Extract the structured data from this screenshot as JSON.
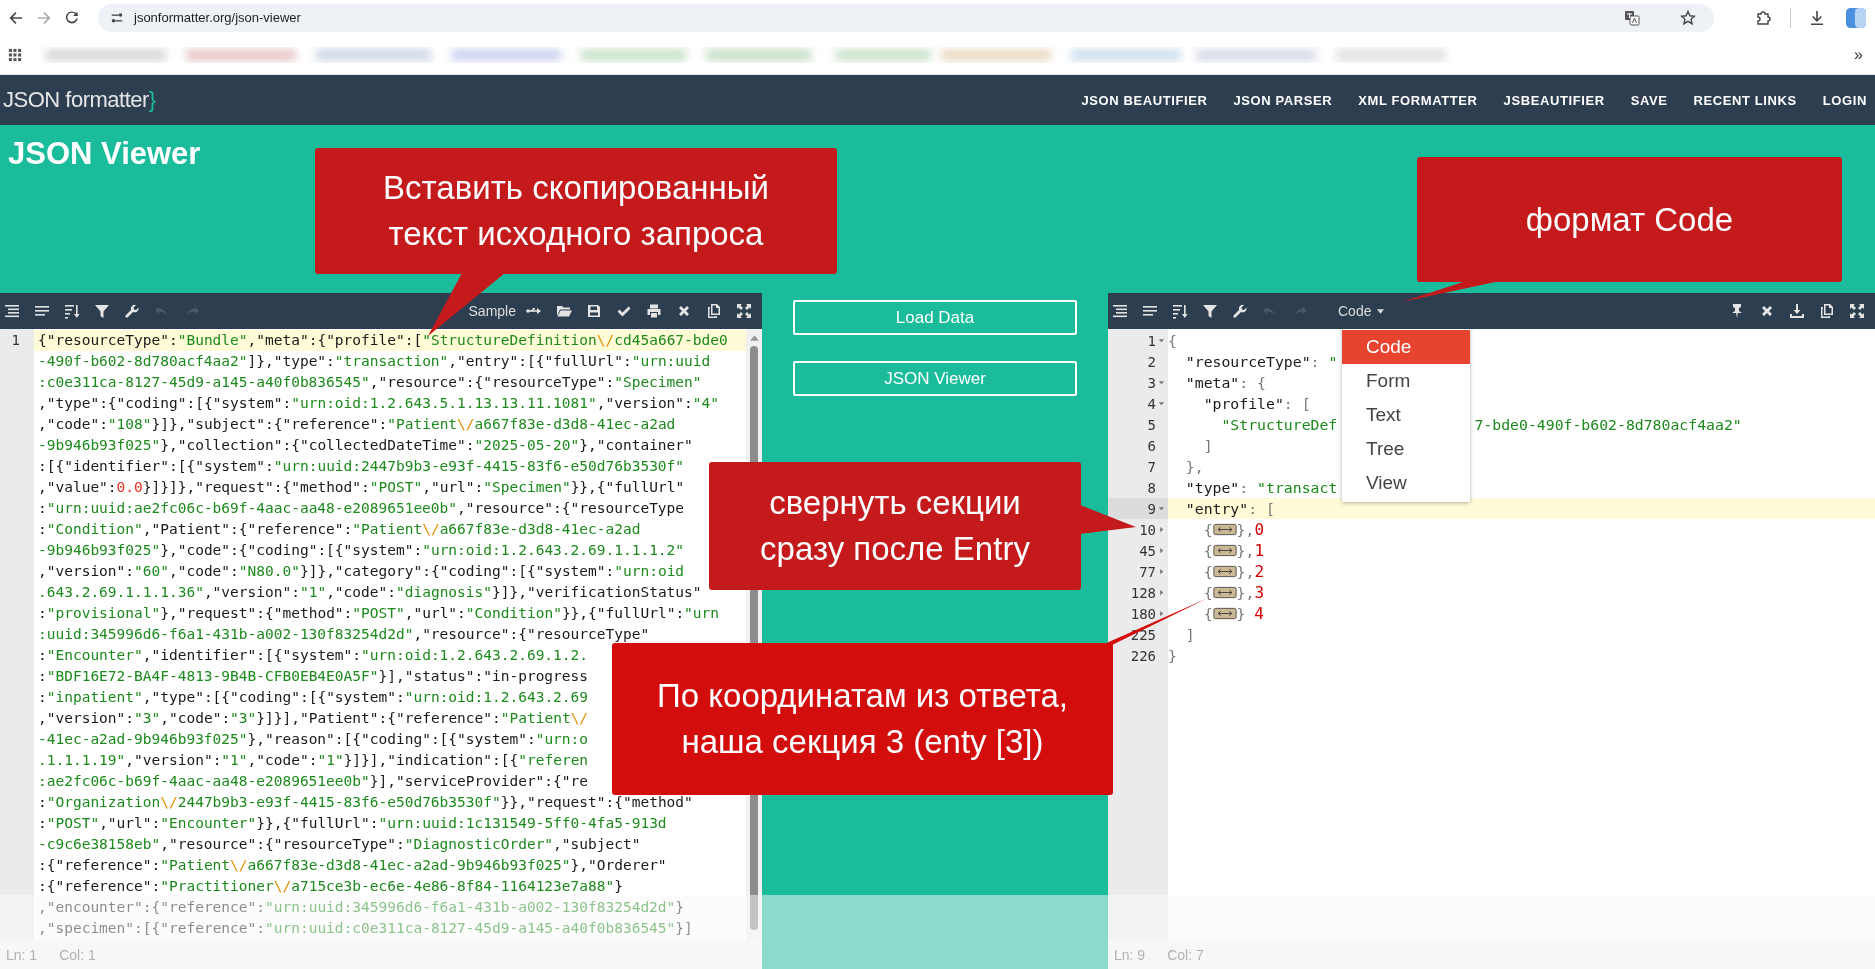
{
  "browser": {
    "url": "jsonformatter.org/json-viewer",
    "overflow": "»"
  },
  "nav": {
    "logo": "JSON formatter",
    "logo_brace": "}",
    "links": [
      "JSON BEAUTIFIER",
      "JSON PARSER",
      "XML FORMATTER",
      "JSBEAUTIFIER",
      "SAVE",
      "RECENT LINKS",
      "LOGIN"
    ]
  },
  "heading": "JSON Viewer",
  "left_editor": {
    "sample_label": "Sample",
    "line_number": "1",
    "lines": [
      {
        "text": "{\"resourceType\":\"Bundle\",\"meta\":{\"profile\":[\"StructureDefinition\\/cd45a667-bde0",
        "continues": false,
        "active": true
      },
      {
        "text": "-490f-b602-8d780acf4aa2\"]},\"type\":\"transaction\",\"entry\":[{\"fullUrl\":\"urn:uuid",
        "continues": true,
        "active": false
      },
      {
        "text": ":c0e311ca-8127-45d9-a145-a40f0b836545\",\"resource\":{\"resourceType\":\"Specimen\"",
        "continues": true,
        "active": false
      },
      {
        "text": ",\"type\":{\"coding\":[{\"system\":\"urn:oid:1.2.643.5.1.13.13.11.1081\",\"version\":\"4\"",
        "continues": false,
        "active": false
      },
      {
        "text": ",\"code\":\"108\"}]},\"subject\":{\"reference\":\"Patient\\/a667f83e-d3d8-41ec-a2ad",
        "continues": false,
        "active": false
      },
      {
        "text": "-9b946b93f025\"},\"collection\":{\"collectedDateTime\":\"2025-05-20\"},\"container\"",
        "continues": true,
        "active": false
      },
      {
        "text": ":[{\"identifier\":[{\"system\":\"urn:uuid:2447b9b3-e93f-4415-83f6-e50d76b3530f\"",
        "continues": false,
        "active": false
      },
      {
        "text": ",\"value\":0.0}]}]},\"request\":{\"method\":\"POST\",\"url\":\"Specimen\"}},{\"fullUrl\"",
        "continues": false,
        "active": false
      },
      {
        "text": ":\"urn:uuid:ae2fc06c-b69f-4aac-aa48-e2089651ee0b\",\"resource\":{\"resourceType",
        "continues": false,
        "active": false
      },
      {
        "text": ":\"Condition\",\"Patient\":{\"reference\":\"Patient\\/a667f83e-d3d8-41ec-a2ad",
        "continues": false,
        "active": false
      },
      {
        "text": "-9b946b93f025\"},\"code\":{\"coding\":[{\"system\":\"urn:oid:1.2.643.2.69.1.1.1.2\"",
        "continues": true,
        "active": false
      },
      {
        "text": ",\"version\":\"60\",\"code\":\"N80.0\"}]},\"category\":{\"coding\":[{\"system\":\"urn:oid",
        "continues": false,
        "active": false
      },
      {
        "text": ".643.2.69.1.1.1.36\",\"version\":\"1\",\"code\":\"diagnosis\"}]},\"verificationStatus\"",
        "continues": true,
        "active": false
      },
      {
        "text": ":\"provisional\"},\"request\":{\"method\":\"POST\",\"url\":\"Condition\"}},{\"fullUrl\":\"urn",
        "continues": false,
        "active": false
      },
      {
        "text": ":uuid:345996d6-f6a1-431b-a002-130f83254d2d\",\"resource\":{\"resourceType\"",
        "continues": true,
        "active": false
      },
      {
        "text": ":\"Encounter\",\"identifier\":[{\"system\":\"urn:oid:1.2.643.2.69.1.2.",
        "continues": false,
        "active": false
      },
      {
        "text": ":\"BDF16E72-BA4F-4813-9B4B-CFB0EB4E0A5F\"}],\"status\":\"in-progress",
        "continues": false,
        "active": false
      },
      {
        "text": ":\"inpatient\",\"type\":[{\"coding\":[{\"system\":\"urn:oid:1.2.643.2.69",
        "continues": false,
        "active": false
      },
      {
        "text": ",\"version\":\"3\",\"code\":\"3\"}]}],\"Patient\":{\"reference\":\"Patient\\/",
        "continues": false,
        "active": false
      },
      {
        "text": "-41ec-a2ad-9b946b93f025\"},\"reason\":[{\"coding\":[{\"system\":\"urn:o",
        "continues": true,
        "active": false
      },
      {
        "text": ".1.1.1.19\",\"version\":\"1\",\"code\":\"1\"}]}],\"indication\":[{\"referen",
        "continues": true,
        "active": false
      },
      {
        "text": ":ae2fc06c-b69f-4aac-aa48-e2089651ee0b\"}],\"serviceProvider\":{\"re",
        "continues": true,
        "active": false
      },
      {
        "text": ":\"Organization\\/2447b9b3-e93f-4415-83f6-e50d76b3530f\"}},\"request\":{\"method\"",
        "continues": false,
        "active": false
      },
      {
        "text": ":\"POST\",\"url\":\"Encounter\"}},{\"fullUrl\":\"urn:uuid:1c131549-5ff0-4fa5-913d",
        "continues": false,
        "active": false
      },
      {
        "text": "-c9c6e38158eb\",\"resource\":{\"resourceType\":\"DiagnosticOrder\",\"subject\"",
        "continues": true,
        "active": false
      },
      {
        "text": ":{\"reference\":\"Patient\\/a667f83e-d3d8-41ec-a2ad-9b946b93f025\"},\"Orderer\"",
        "continues": false,
        "active": false
      },
      {
        "text": ":{\"reference\":\"Practitioner\\/a715ce3b-ec6e-4e86-8f84-1164123e7a88\"}",
        "continues": false,
        "active": false
      },
      {
        "text": ",\"encounter\":{\"reference\":\"urn:uuid:345996d6-f6a1-431b-a002-130f83254d2d\"}",
        "continues": false,
        "active": false
      },
      {
        "text": ",\"specimen\":[{\"reference\":\"urn:uuid:c0e311ca-8127-45d9-a145-a40f0b836545\"}]",
        "continues": false,
        "active": false
      }
    ],
    "status": {
      "line": "Ln: 1",
      "column": "Col: 1"
    }
  },
  "middle_buttons": [
    "Load Data",
    "JSON Viewer"
  ],
  "right_editor": {
    "mode_button": "Code",
    "mode_menu": [
      {
        "label": "Code",
        "selected": true
      },
      {
        "label": "Form",
        "selected": false
      },
      {
        "label": "Text",
        "selected": false
      },
      {
        "label": "Tree",
        "selected": false
      },
      {
        "label": "View",
        "selected": false
      }
    ],
    "lines": [
      {
        "number": "1",
        "expanded": true,
        "text": "{",
        "active": false
      },
      {
        "number": "2",
        "text": "  \"resourceType\": \"",
        "active": false
      },
      {
        "number": "3",
        "expanded": true,
        "text": "  \"meta\": {",
        "active": false
      },
      {
        "number": "4",
        "expanded": true,
        "text": "    \"profile\": [",
        "active": false
      },
      {
        "number": "5",
        "text": "      \"StructureDef",
        "tail": "7-bde0-490f-b602-8d780acf4aa2\"",
        "active": false
      },
      {
        "number": "6",
        "text": "    ]",
        "active": false
      },
      {
        "number": "7",
        "text": "  },",
        "active": false
      },
      {
        "number": "8",
        "text": "  \"type\": \"transact",
        "active": false
      },
      {
        "number": "9",
        "expanded": true,
        "text": "  \"entry\": [",
        "active": true
      },
      {
        "number": "10",
        "expanded": false,
        "kind": "collapsed",
        "text": "    {",
        "close": "},",
        "index": "0",
        "active": false
      },
      {
        "number": "45",
        "expanded": false,
        "kind": "collapsed",
        "text": "    {",
        "close": "},",
        "index": "1",
        "active": false
      },
      {
        "number": "77",
        "expanded": false,
        "kind": "collapsed",
        "text": "    {",
        "close": "},",
        "index": "2",
        "active": false
      },
      {
        "number": "128",
        "expanded": false,
        "kind": "collapsed",
        "text": "    {",
        "close": "},",
        "index": "3",
        "active": false
      },
      {
        "number": "180",
        "expanded": false,
        "kind": "collapsed",
        "text": "    {",
        "close": "}",
        "index": "4",
        "active": false
      },
      {
        "number": "225",
        "text": "  ]",
        "active": false
      },
      {
        "number": "226",
        "text": "}",
        "active": false
      }
    ],
    "status": {
      "line": "Ln: 9",
      "column": "Col: 7"
    }
  },
  "annotations": [
    "Вставить скопированный\nтекст исходного запроса",
    "формат Code",
    "свернуть секции\nсразу после Entry",
    "По координатам из ответа,\nнаша секция 3 (enty [3])"
  ]
}
